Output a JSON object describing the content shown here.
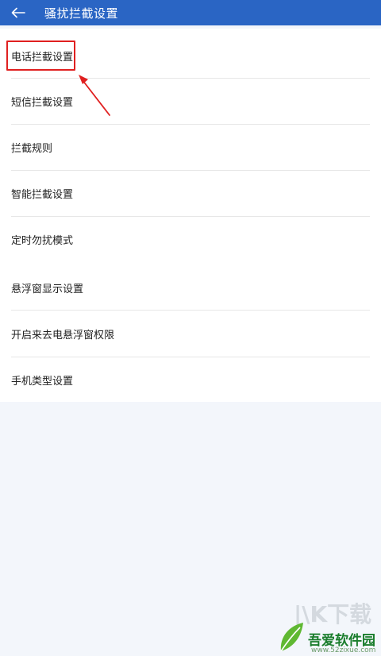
{
  "header": {
    "title": "骚扰拦截设置",
    "back_icon": "arrow-left-icon",
    "background": "#2a65c4"
  },
  "settings_list": {
    "items": [
      {
        "label": "电话拦截设置"
      },
      {
        "label": "短信拦截设置"
      },
      {
        "label": "拦截规则"
      },
      {
        "label": "智能拦截设置"
      },
      {
        "label": "定时勿扰模式"
      },
      {
        "label": "悬浮窗显示设置"
      },
      {
        "label": "开启来去电悬浮窗权限"
      },
      {
        "label": "手机类型设置"
      }
    ]
  },
  "annotation": {
    "highlight_color": "#e02020"
  },
  "watermark": {
    "faint_text": "|\\K下载",
    "brand": "吾爱软件园",
    "site": "www.52zixue.com"
  }
}
